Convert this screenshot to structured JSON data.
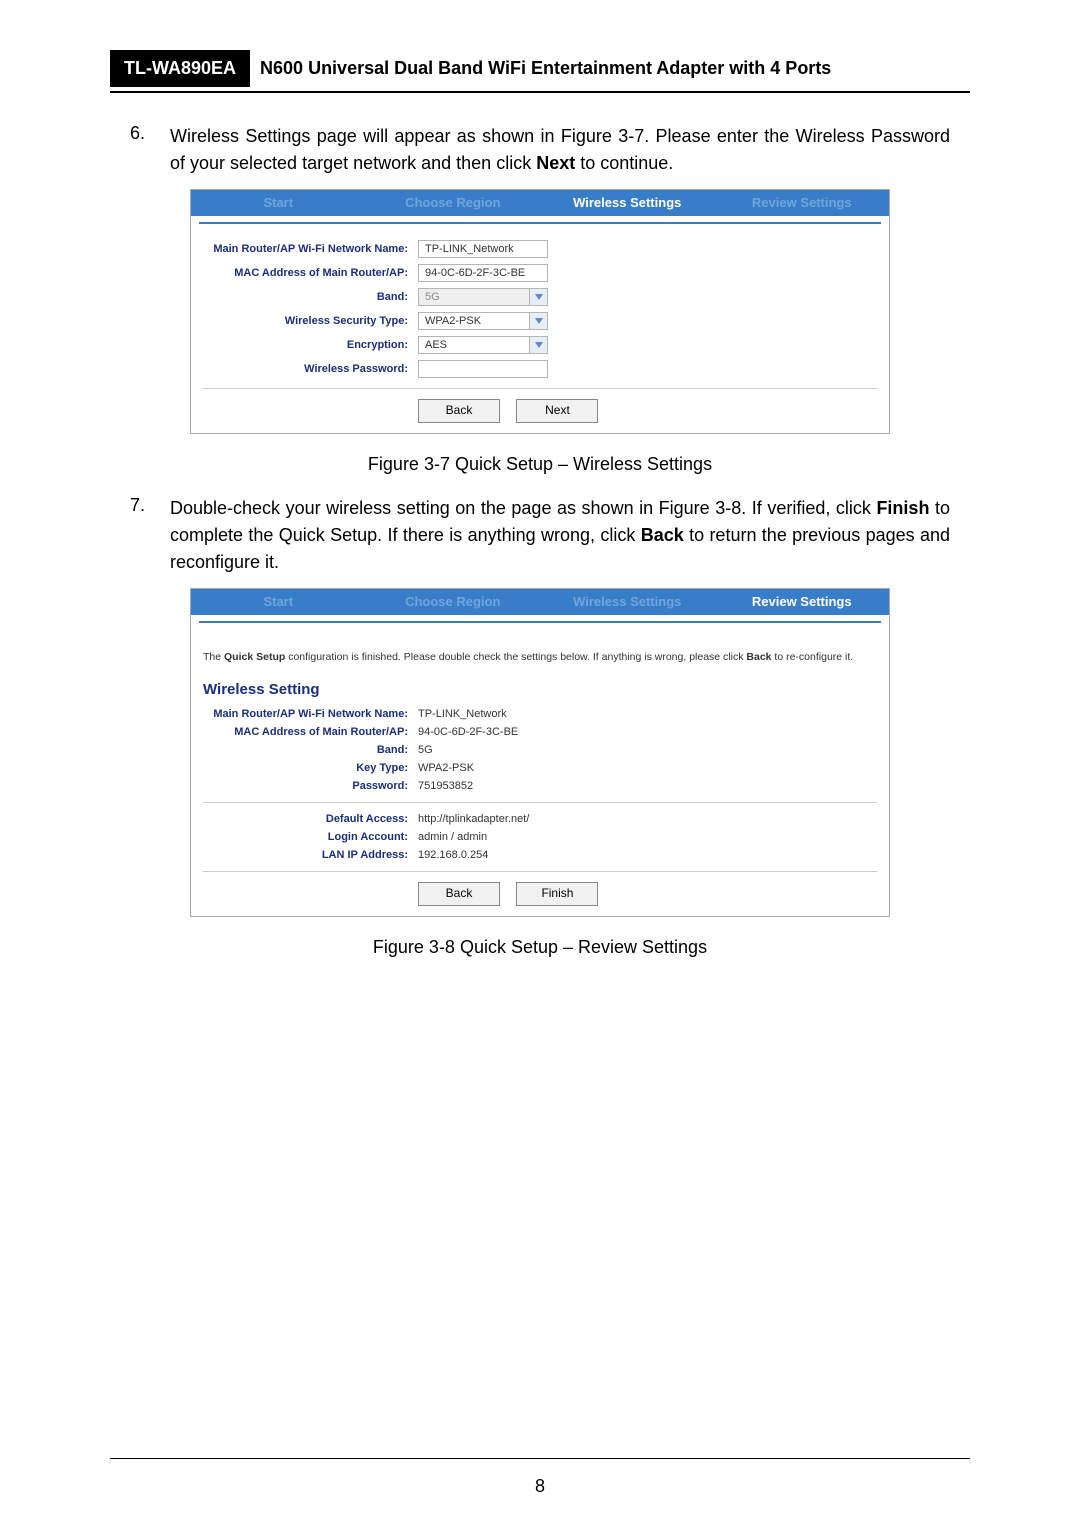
{
  "header": {
    "model": "TL-WA890EA",
    "title": "N600 Universal Dual Band WiFi Entertainment Adapter with 4 Ports"
  },
  "step6": {
    "num": "6.",
    "text_before": "Wireless Settings page will appear as shown in Figure 3-7. Please enter the Wireless Password of your selected target network and then click ",
    "bold": "Next",
    "text_after": " to continue."
  },
  "fig1": {
    "tabs": {
      "start": "Start",
      "region": "Choose Region",
      "wireless": "Wireless Settings",
      "review": "Review Settings"
    },
    "labels": {
      "network_name": "Main Router/AP Wi-Fi Network Name:",
      "mac": "MAC Address of Main Router/AP:",
      "band": "Band:",
      "sec_type": "Wireless Security Type:",
      "encryption": "Encryption:",
      "password": "Wireless Password:"
    },
    "values": {
      "network_name": "TP-LINK_Network",
      "mac": "94-0C-6D-2F-3C-BE",
      "band": "5G",
      "sec_type": "WPA2-PSK",
      "encryption": "AES",
      "password": ""
    },
    "buttons": {
      "back": "Back",
      "next": "Next"
    },
    "caption": "Figure 3-7 Quick Setup – Wireless Settings"
  },
  "step7": {
    "num": "7.",
    "t1": "Double-check your wireless setting on the page as shown in Figure 3-8. If verified, click ",
    "b1": "Finish",
    "t2": " to complete the Quick Setup. If there is anything wrong, click ",
    "b2": "Back",
    "t3": " to return the previous pages and reconfigure it."
  },
  "fig2": {
    "tabs": {
      "start": "Start",
      "region": "Choose Region",
      "wireless": "Wireless Settings",
      "review": "Review Settings"
    },
    "intro_before": "The ",
    "intro_bold1": "Quick Setup",
    "intro_mid": " configuration is finished. Please double check the settings below. If anything is wrong, please click ",
    "intro_bold2": "Back",
    "intro_after": " to re-configure it.",
    "section": "Wireless Setting",
    "labels": {
      "network_name": "Main Router/AP Wi-Fi Network Name:",
      "mac": "MAC Address of Main Router/AP:",
      "band": "Band:",
      "key_type": "Key Type:",
      "password": "Password:",
      "default_access": "Default Access:",
      "login": "Login Account:",
      "lan_ip": "LAN IP Address:"
    },
    "values": {
      "network_name": "TP-LINK_Network",
      "mac": "94-0C-6D-2F-3C-BE",
      "band": "5G",
      "key_type": "WPA2-PSK",
      "password": "751953852",
      "default_access": "http://tplinkadapter.net/",
      "login": "admin / admin",
      "lan_ip": "192.168.0.254"
    },
    "buttons": {
      "back": "Back",
      "finish": "Finish"
    },
    "caption": "Figure 3-8 Quick Setup – Review Settings"
  },
  "page_number": "8"
}
